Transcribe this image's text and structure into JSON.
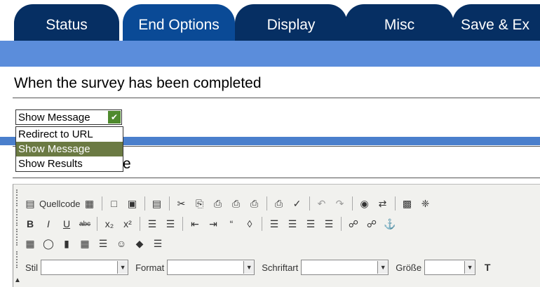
{
  "tabs": [
    {
      "label": "Status",
      "active": false
    },
    {
      "label": "End Options",
      "active": true
    },
    {
      "label": "Display",
      "active": false
    },
    {
      "label": "Misc",
      "active": false
    },
    {
      "label": "Save & Ex",
      "active": false
    }
  ],
  "section": {
    "heading": "When the survey has been completed",
    "partial_label": "e"
  },
  "end_action": {
    "selected": "Show Message",
    "options": [
      "Redirect to URL",
      "Show Message",
      "Show Results"
    ]
  },
  "editor": {
    "source_label": "Quellcode",
    "style_label": "Stil",
    "format_label": "Format",
    "font_label": "Schriftart",
    "size_label": "Größe"
  },
  "colors": {
    "tab_bg": "#062f63",
    "tab_active_bg": "#0a4a96",
    "band": "#5b8ddb",
    "dropdown_selected": "#6b7a43"
  }
}
